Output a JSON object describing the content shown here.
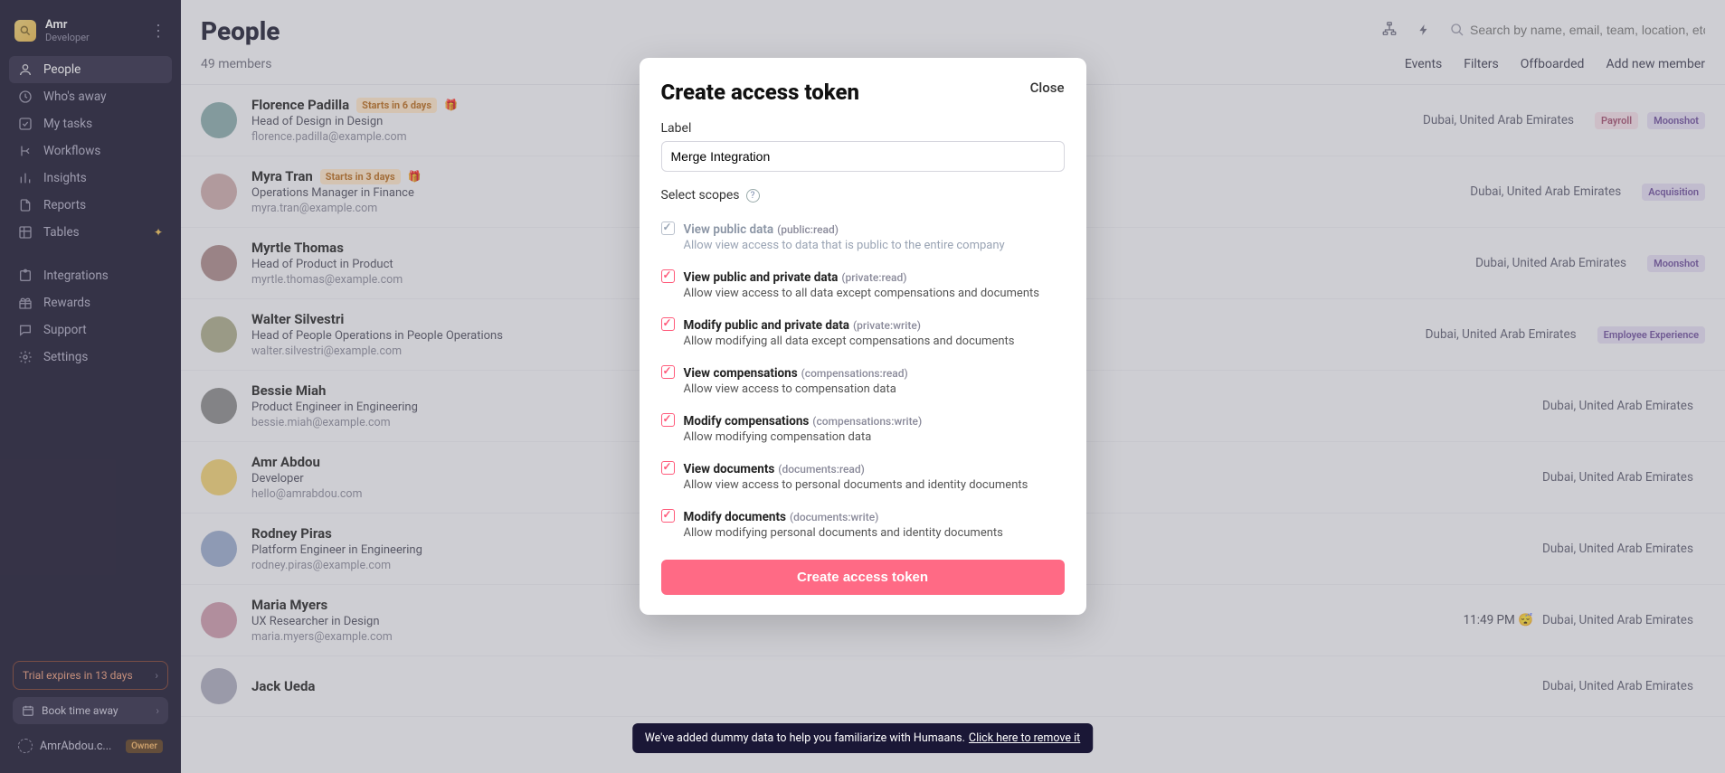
{
  "user": {
    "name": "Amr",
    "role": "Developer"
  },
  "nav": [
    {
      "key": "people",
      "label": "People",
      "icon": "user"
    },
    {
      "key": "whos-away",
      "label": "Who's away",
      "icon": "clock"
    },
    {
      "key": "my-tasks",
      "label": "My tasks",
      "icon": "check-square"
    },
    {
      "key": "workflows",
      "label": "Workflows",
      "icon": "branch"
    },
    {
      "key": "insights",
      "label": "Insights",
      "icon": "bars"
    },
    {
      "key": "reports",
      "label": "Reports",
      "icon": "file"
    },
    {
      "key": "tables",
      "label": "Tables",
      "icon": "grid",
      "spark": true
    }
  ],
  "nav2": [
    {
      "key": "integrations",
      "label": "Integrations",
      "icon": "puzzle"
    },
    {
      "key": "rewards",
      "label": "Rewards",
      "icon": "gift"
    },
    {
      "key": "support",
      "label": "Support",
      "icon": "chat"
    },
    {
      "key": "settings",
      "label": "Settings",
      "icon": "gear"
    }
  ],
  "footer": {
    "trial": "Trial expires in 13 days",
    "book": "Book time away",
    "workspace": "AmrAbdou.c...",
    "owner": "Owner"
  },
  "page": {
    "title": "People",
    "members": "49 members",
    "searchPlaceholder": "Search by name, email, team, location, etc",
    "tabs": [
      "Events",
      "Filters",
      "Offboarded",
      "Add new member"
    ]
  },
  "people_location": "Dubai, United Arab Emirates",
  "people": [
    {
      "name": "Florence Padilla",
      "role": "Head of Design in Design",
      "email": "florence.padilla@example.com",
      "badge": "Starts in 6 days",
      "gift": true,
      "tags": [
        "Payroll",
        "Moonshot"
      ]
    },
    {
      "name": "Myra Tran",
      "role": "Operations Manager in Finance",
      "email": "myra.tran@example.com",
      "badge": "Starts in 3 days",
      "gift": true,
      "tags": [
        "Acquisition"
      ]
    },
    {
      "name": "Myrtle Thomas",
      "role": "Head of Product in Product",
      "email": "myrtle.thomas@example.com",
      "tags": [
        "Moonshot"
      ]
    },
    {
      "name": "Walter Silvestri",
      "role": "Head of People Operations in People Operations",
      "email": "walter.silvestri@example.com",
      "tags": [
        "Employee Experience"
      ]
    },
    {
      "name": "Bessie Miah",
      "role": "Product Engineer in Engineering",
      "email": "bessie.miah@example.com"
    },
    {
      "name": "Amr Abdou",
      "role": "Developer",
      "email": "hello@amrabdou.com"
    },
    {
      "name": "Rodney Piras",
      "role": "Platform Engineer in Engineering",
      "email": "rodney.piras@example.com"
    },
    {
      "name": "Maria Myers",
      "role": "UX Researcher in Design",
      "email": "maria.myers@example.com",
      "time": "11:49 PM",
      "emoji": "😴"
    },
    {
      "name": "Jack Ueda",
      "role": "",
      "email": ""
    }
  ],
  "modal": {
    "title": "Create access token",
    "close": "Close",
    "labelField": "Label",
    "labelValue": "Merge Integration",
    "scopesHead": "Select scopes",
    "create": "Create access token",
    "scopes": [
      {
        "title": "View public data",
        "id": "(public:read)",
        "desc": "Allow view access to data that is public to the entire company",
        "checked": true,
        "disabled": true
      },
      {
        "title": "View public and private data",
        "id": "(private:read)",
        "desc": "Allow view access to all data except compensations and documents",
        "checked": true
      },
      {
        "title": "Modify public and private data",
        "id": "(private:write)",
        "desc": "Allow modifying all data except compensations and documents",
        "checked": true
      },
      {
        "title": "View compensations",
        "id": "(compensations:read)",
        "desc": "Allow view access to compensation data",
        "checked": true
      },
      {
        "title": "Modify compensations",
        "id": "(compensations:write)",
        "desc": "Allow modifying compensation data",
        "checked": true
      },
      {
        "title": "View documents",
        "id": "(documents:read)",
        "desc": "Allow view access to personal documents and identity documents",
        "checked": true
      },
      {
        "title": "Modify documents",
        "id": "(documents:write)",
        "desc": "Allow modifying personal documents and identity documents",
        "checked": true
      }
    ]
  },
  "toast": {
    "text": "We've added dummy data to help you familiarize with Humaans. ",
    "link": "Click here to remove it"
  }
}
